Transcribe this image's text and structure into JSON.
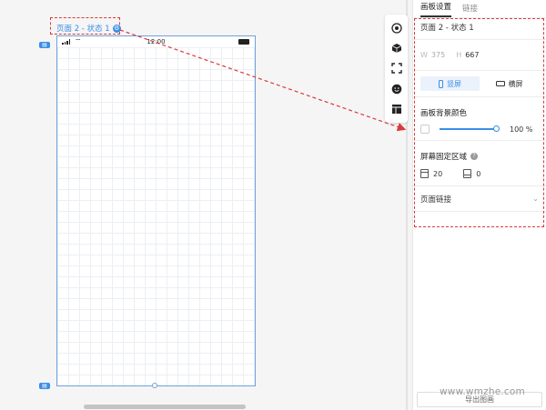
{
  "canvas": {
    "frame_label": "页面 2 - 状态 1",
    "status_time": "12:00"
  },
  "tools": [
    {
      "icon": "target-icon"
    },
    {
      "icon": "cube-icon"
    },
    {
      "icon": "crop-icon"
    },
    {
      "icon": "smile-icon"
    },
    {
      "icon": "layout-icon"
    }
  ],
  "panel": {
    "tabs": [
      {
        "label": "画板设置",
        "active": true
      },
      {
        "label": "链接",
        "active": false
      }
    ],
    "page_name": "页面 2 - 状态 1",
    "width_label": "W",
    "width_value": "375",
    "height_label": "H",
    "height_value": "667",
    "orientation": {
      "portrait_label": "竖屏",
      "landscape_label": "横屏",
      "selected": "portrait"
    },
    "bg_color_title": "画板背景颜色",
    "bg_opacity": "100",
    "bg_opacity_unit": "%",
    "fixed_area_title": "屏幕固定区域",
    "fixed_top_value": "20",
    "fixed_bottom_value": "0",
    "page_link_label": "页面链接",
    "export_label": "导出图画"
  },
  "watermark": "www.wmzhe.com",
  "colors": {
    "accent": "#3a8ee6",
    "annotation": "#d93a3a"
  }
}
